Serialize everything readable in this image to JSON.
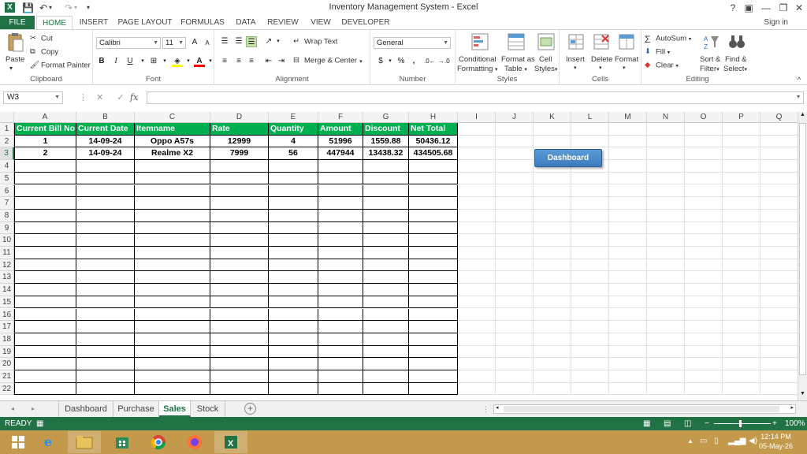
{
  "window": {
    "title": "Inventory Management System - Excel",
    "controls": {
      "help": "?",
      "ribbon_opts": "▣",
      "minimize": "—",
      "restore": "❐",
      "close": "✕"
    }
  },
  "qat": {
    "save_icon": "save-icon",
    "undo": "↶",
    "redo": "↷",
    "customize": "▾"
  },
  "tabs": [
    "FILE",
    "HOME",
    "INSERT",
    "PAGE LAYOUT",
    "FORMULAS",
    "DATA",
    "REVIEW",
    "VIEW",
    "DEVELOPER"
  ],
  "signin": "Sign in",
  "ribbon": {
    "clipboard": {
      "label": "Clipboard",
      "paste": "Paste",
      "cut": "Cut",
      "copy": "Copy",
      "format_painter": "Format Painter"
    },
    "font": {
      "label": "Font",
      "name": "Calibri",
      "size": "11",
      "bold": "B",
      "italic": "I",
      "underline": "U",
      "grow": "A",
      "shrink": "A"
    },
    "alignment": {
      "label": "Alignment",
      "wrap": "Wrap Text",
      "merge": "Merge & Center"
    },
    "number": {
      "label": "Number",
      "format": "General",
      "currency": "$",
      "percent": "%",
      "comma": ","
    },
    "styles": {
      "label": "Styles",
      "conditional1": "Conditional",
      "conditional2": "Formatting",
      "table1": "Format as",
      "table2": "Table",
      "cell1": "Cell",
      "cell2": "Styles"
    },
    "cells": {
      "label": "Cells",
      "insert": "Insert",
      "delete": "Delete",
      "format": "Format"
    },
    "editing": {
      "label": "Editing",
      "autosum": "AutoSum",
      "fill": "Fill",
      "clear": "Clear",
      "sort1": "Sort &",
      "sort2": "Filter",
      "find1": "Find &",
      "find2": "Select"
    }
  },
  "formula_bar": {
    "name_box": "W3",
    "fx": "fx",
    "value": ""
  },
  "columns": [
    "A",
    "B",
    "C",
    "D",
    "E",
    "F",
    "G",
    "H",
    "I",
    "J",
    "K",
    "L",
    "M",
    "N",
    "O",
    "P",
    "Q"
  ],
  "rows": [
    "1",
    "2",
    "3",
    "4",
    "5",
    "6",
    "7",
    "8",
    "9",
    "10",
    "11",
    "12",
    "13",
    "14",
    "15",
    "16",
    "17",
    "18",
    "19",
    "20",
    "21",
    "22"
  ],
  "table": {
    "headers": [
      "Current Bill No",
      "Current Date",
      "Itemname",
      "Rate",
      "Quantity",
      "Amount",
      "Discount",
      "Net Total"
    ],
    "rows": [
      [
        "1",
        "14-09-24",
        "Oppo A57s",
        "12999",
        "4",
        "51996",
        "1559.88",
        "50436.12"
      ],
      [
        "2",
        "14-09-24",
        "Realme X2",
        "7999",
        "56",
        "447944",
        "13438.32",
        "434505.68"
      ]
    ],
    "header_color": "#00B050"
  },
  "dashboard_button": "Dashboard",
  "sheets": [
    "Dashboard",
    "Purchase",
    "Sales",
    "Stock"
  ],
  "active_sheet": "Sales",
  "status": {
    "ready": "READY",
    "zoom": "100%"
  },
  "taskbar": {
    "time": "12:14 PM",
    "date": "05-May-26"
  },
  "accent_color": "#217346"
}
